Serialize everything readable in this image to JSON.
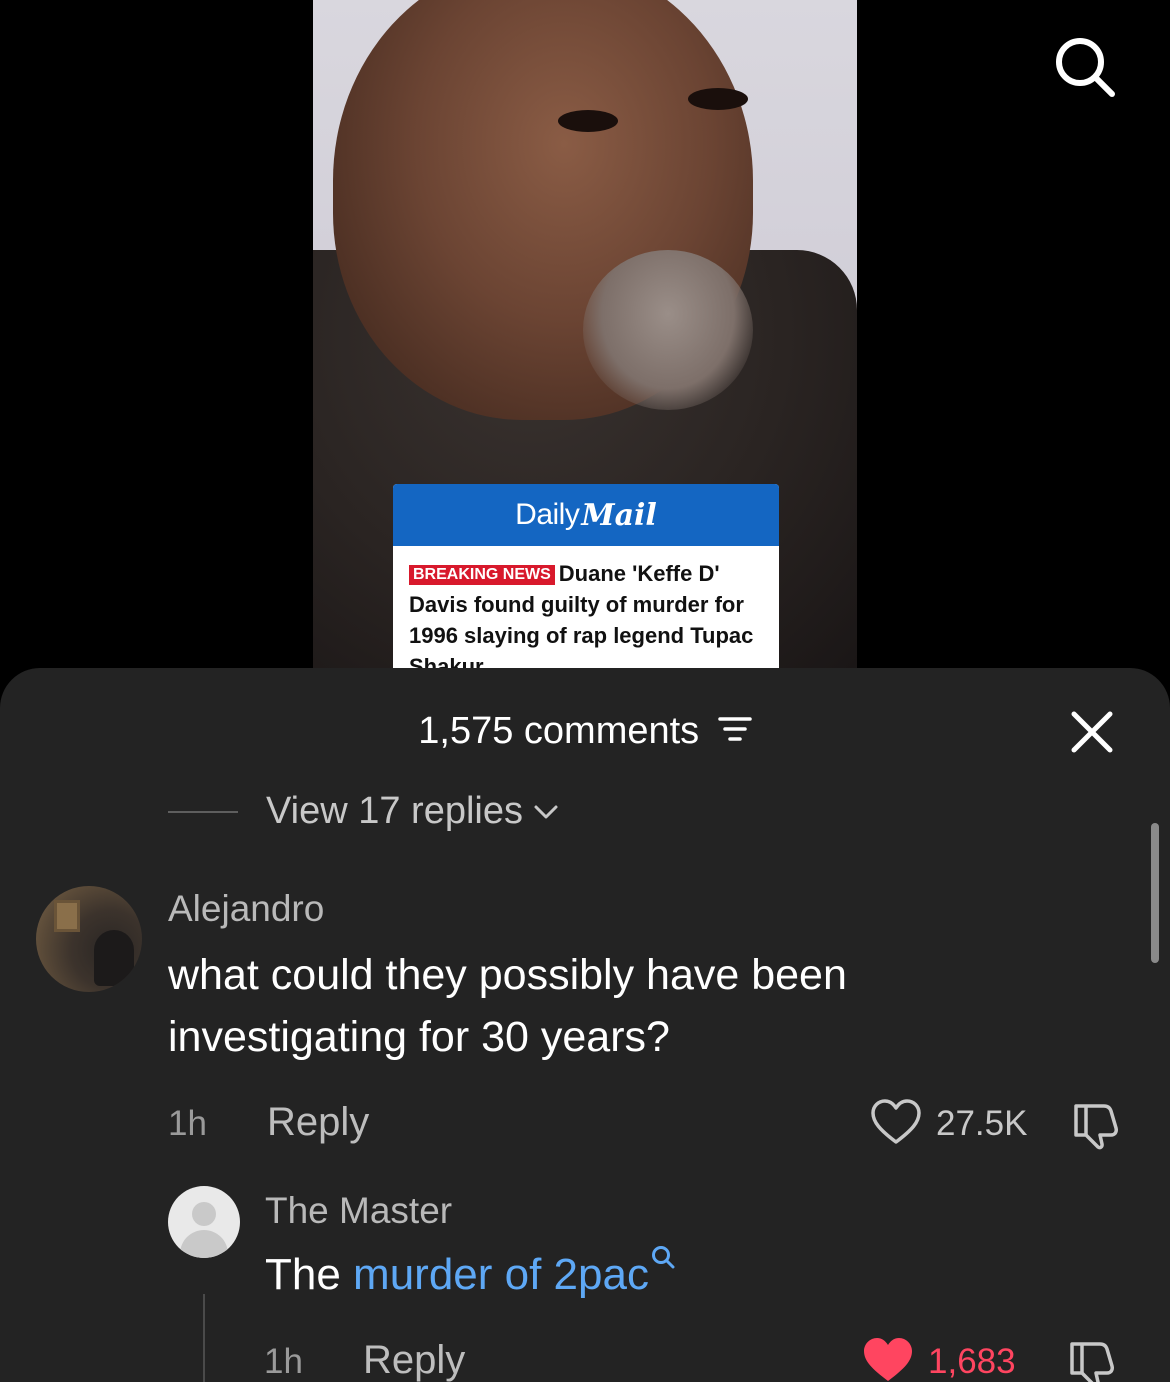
{
  "video": {
    "card_brand_daily": "Daily",
    "card_brand_mail": "Mail",
    "breaking_label": "BREAKING NEWS",
    "headline": "Duane 'Keffe D' Davis found guilty of murder for 1996 slaying of rap legend Tupac Shakur"
  },
  "sheet": {
    "title": "1,575 comments",
    "view_replies": "View 17 replies"
  },
  "comments": [
    {
      "author": "Alejandro",
      "text": "what could they possibly have been investigating for 30 years?",
      "time": "1h",
      "reply_label": "Reply",
      "likes": "27.5K",
      "liked": false
    },
    {
      "author": "The Master",
      "text_prefix": "The ",
      "text_link": "murder of 2pac",
      "time": "1h",
      "reply_label": "Reply",
      "likes": "1,683",
      "liked": true
    }
  ],
  "colors": {
    "sheet_bg": "#232323",
    "link_blue": "#5ea8f5",
    "like_red": "#ff4560",
    "dm_blue": "#1466c2",
    "breaking_red": "#d8192c"
  },
  "icons": [
    "search-icon",
    "filter-icon",
    "close-icon",
    "chevron-down-icon",
    "heart-icon",
    "dislike-icon",
    "search-link-icon"
  ]
}
